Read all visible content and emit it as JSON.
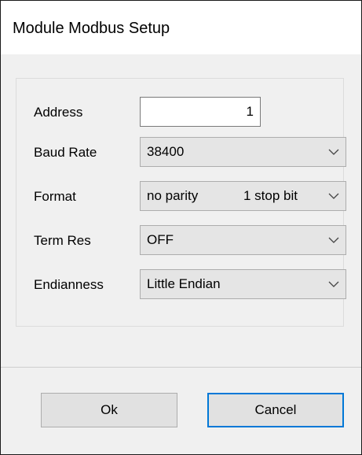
{
  "window": {
    "title": "Module Modbus Setup"
  },
  "fields": {
    "address": {
      "label": "Address",
      "value": "1"
    },
    "baud_rate": {
      "label": "Baud Rate",
      "value": "38400"
    },
    "format": {
      "label": "Format",
      "value_parity": "no parity",
      "value_stop": "1 stop bit"
    },
    "term_res": {
      "label": "Term Res",
      "value": "OFF"
    },
    "endianness": {
      "label": "Endianness",
      "value": "Little Endian"
    }
  },
  "buttons": {
    "ok": "Ok",
    "cancel": "Cancel"
  },
  "icons": {
    "dropdown": "chevron-down-icon"
  },
  "colors": {
    "focus_border": "#0078d7",
    "dialog_bg": "#f0f0f0",
    "combo_bg": "#e5e5e5"
  }
}
